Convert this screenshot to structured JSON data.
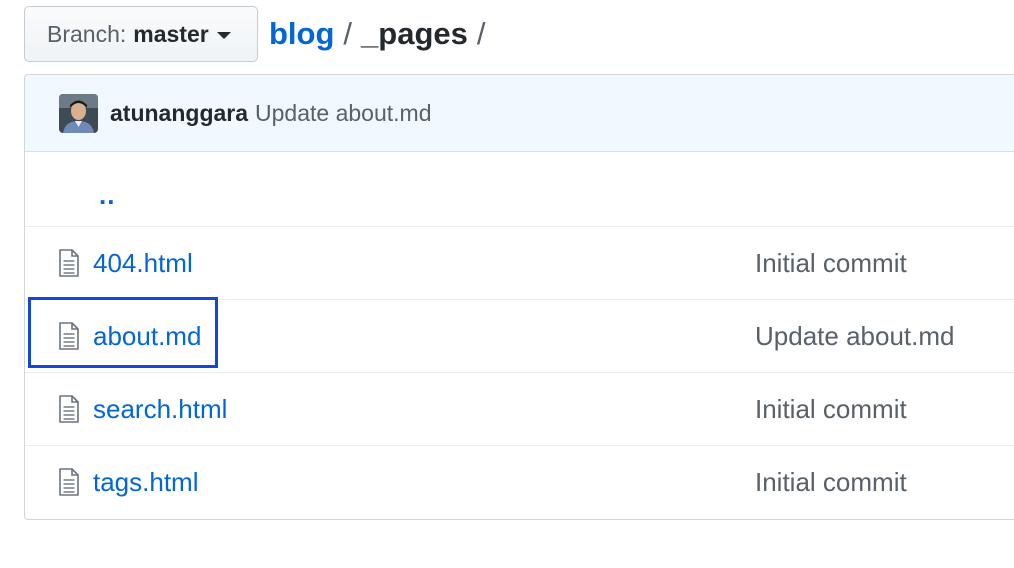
{
  "branch": {
    "label": "Branch:",
    "name": "master",
    "caret_icon": "caret-down-icon"
  },
  "breadcrumb": {
    "repo": "blog",
    "separator": "/",
    "dir": "_pages"
  },
  "latest_commit": {
    "author": "atunanggara",
    "message": "Update about.md"
  },
  "parent_dir": "..",
  "files": [
    {
      "icon": "file-icon",
      "name": "404.html",
      "commit_message": "Initial commit"
    },
    {
      "icon": "file-icon",
      "name": "about.md",
      "commit_message": "Update about.md"
    },
    {
      "icon": "file-icon",
      "name": "search.html",
      "commit_message": "Initial commit"
    },
    {
      "icon": "file-icon",
      "name": "tags.html",
      "commit_message": "Initial commit"
    }
  ],
  "colors": {
    "link": "#0366d6",
    "commit_bar_bg": "#f1f8ff",
    "highlight": "#1249d4"
  }
}
